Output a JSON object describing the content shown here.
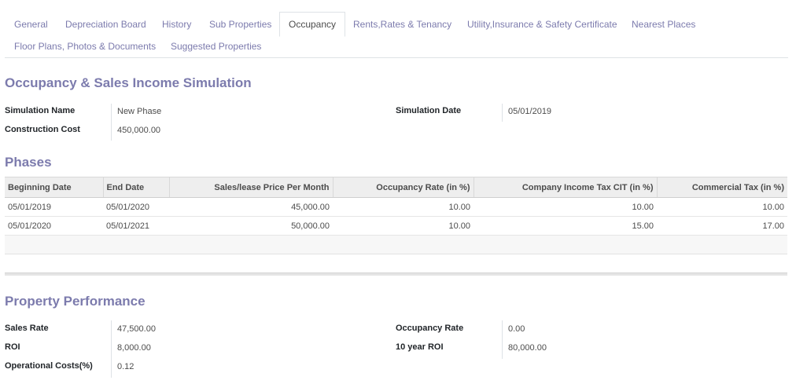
{
  "tabs": [
    {
      "label": "General"
    },
    {
      "label": "Depreciation Board"
    },
    {
      "label": "History"
    },
    {
      "label": "Sub Properties"
    },
    {
      "label": "Occupancy"
    },
    {
      "label": "Rents,Rates & Tenancy"
    },
    {
      "label": "Utility,Insurance & Safety Certificate"
    },
    {
      "label": "Nearest Places"
    },
    {
      "label": "Floor Plans, Photos & Documents"
    },
    {
      "label": "Suggested Properties"
    }
  ],
  "active_tab": "Occupancy",
  "simulation": {
    "title": "Occupancy & Sales Income Simulation",
    "fields": {
      "simulation_name_label": "Simulation Name",
      "simulation_name_value": "New Phase",
      "construction_cost_label": "Construction Cost",
      "construction_cost_value": "450,000.00",
      "simulation_date_label": "Simulation Date",
      "simulation_date_value": "05/01/2019"
    }
  },
  "phases": {
    "title": "Phases",
    "columns": [
      "Beginning Date",
      "End Date",
      "Sales/lease Price Per Month",
      "Occupancy Rate (in %)",
      "Company Income Tax CIT (in %)",
      "Commercial Tax (in %)"
    ],
    "rows": [
      [
        "05/01/2019",
        "05/01/2020",
        "45,000.00",
        "10.00",
        "10.00",
        "10.00"
      ],
      [
        "05/01/2020",
        "05/01/2021",
        "50,000.00",
        "10.00",
        "15.00",
        "17.00"
      ]
    ]
  },
  "performance": {
    "title": "Property Performance",
    "fields": {
      "sales_rate_label": "Sales Rate",
      "sales_rate_value": "47,500.00",
      "roi_label": "ROI",
      "roi_value": "8,000.00",
      "operational_costs_label": "Operational Costs(%)",
      "operational_costs_value": "0.12",
      "occupancy_rate_label": "Occupancy Rate",
      "occupancy_rate_value": "0.00",
      "ten_year_roi_label": "10 year ROI",
      "ten_year_roi_value": "80,000.00"
    }
  },
  "colors": {
    "accent": "#7c7bad",
    "text": "#4c4c4c",
    "header_bg": "#eeeeee"
  }
}
